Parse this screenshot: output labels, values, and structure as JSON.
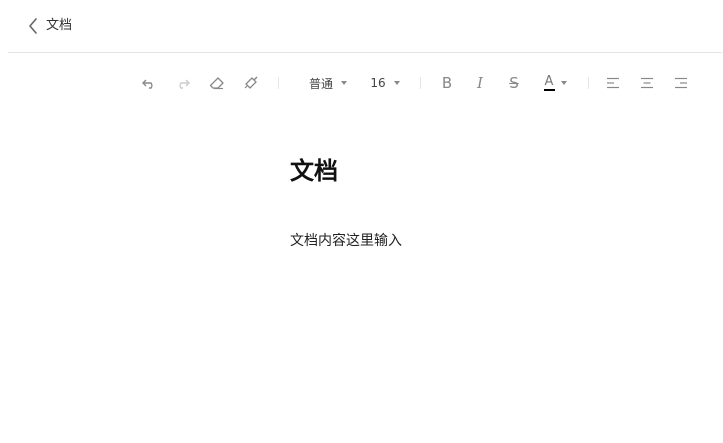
{
  "header": {
    "back_label": "文档"
  },
  "toolbar": {
    "undo_icon": "undo-icon",
    "redo_icon": "redo-icon",
    "eraser_icon": "eraser-icon",
    "format_painter_icon": "format-painter-icon",
    "paragraph_style": "普通",
    "font_size": "16",
    "bold_glyph": "B",
    "italic_glyph": "I",
    "strike_glyph": "S",
    "font_color_glyph": "A",
    "font_color": "#000000",
    "align_left_icon": "align-left-icon",
    "align_center_icon": "align-center-icon",
    "align_right_icon": "align-right-icon",
    "enabled_icon_color": "#888888",
    "disabled_icon_color": "#cccccc"
  },
  "document": {
    "title": "文档",
    "body": "文档内容这里输入"
  }
}
